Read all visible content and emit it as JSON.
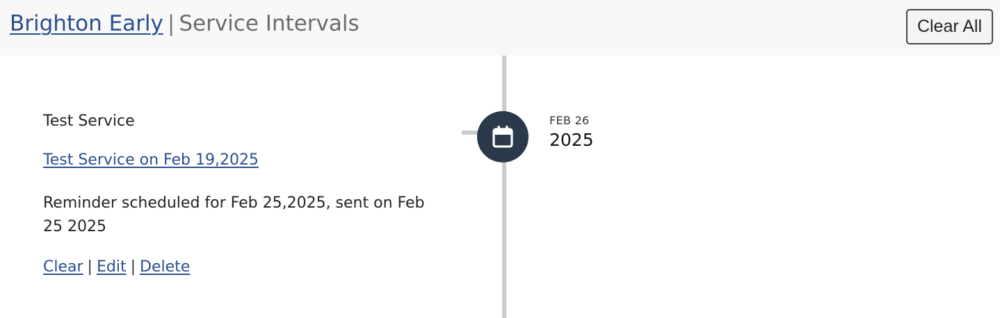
{
  "header": {
    "title_link": "Brighton Early",
    "separator": "|",
    "subtitle": "Service Intervals",
    "clear_all_label": "Clear All"
  },
  "timeline": {
    "marker_icon": "calendar-icon",
    "marker_color": "#2b3a4a",
    "line_color": "#cccccc",
    "date_month": "FEB 26",
    "date_year": "2025"
  },
  "entry": {
    "service_name": "Test Service",
    "service_link": "Test Service on Feb 19,2025",
    "reminder_text": "Reminder scheduled for Feb 25,2025, sent on Feb 25 2025",
    "actions": {
      "clear": "Clear",
      "edit": "Edit",
      "delete": "Delete",
      "separator": "|"
    }
  },
  "colors": {
    "link": "#2a4d8f",
    "header_bg": "#f8f8f8"
  }
}
